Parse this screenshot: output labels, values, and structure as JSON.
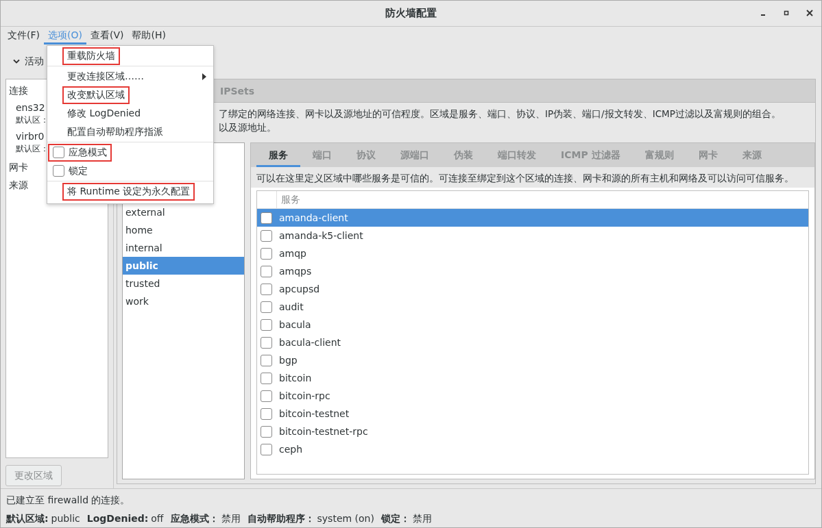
{
  "window": {
    "title": "防火墙配置"
  },
  "menu_bar": [
    {
      "label": "文件(F)",
      "selected": false
    },
    {
      "label": "选项(O)",
      "selected": true
    },
    {
      "label": "查看(V)",
      "selected": false
    },
    {
      "label": "帮助(H)",
      "selected": false
    }
  ],
  "open_menu": {
    "items": [
      {
        "kind": "action",
        "label": "重载防火墙",
        "highlighted": true
      },
      {
        "kind": "separator"
      },
      {
        "kind": "submenu",
        "label": "更改连接区域……",
        "highlighted": false
      },
      {
        "kind": "action",
        "label": "改变默认区域",
        "highlighted": true
      },
      {
        "kind": "action",
        "label": "修改  LogDenied",
        "highlighted": false
      },
      {
        "kind": "action",
        "label": "配置自动帮助程序指派",
        "highlighted": false
      },
      {
        "kind": "separator"
      },
      {
        "kind": "check",
        "label": "应急模式",
        "checked": false,
        "highlighted": true
      },
      {
        "kind": "check",
        "label": "锁定",
        "checked": false,
        "highlighted": false
      },
      {
        "kind": "separator"
      },
      {
        "kind": "action",
        "label": "将  Runtime 设定为永久配置",
        "highlighted": true
      }
    ]
  },
  "bindings_panel": {
    "header": "活动",
    "items": [
      {
        "kind": "group",
        "label": "连接"
      },
      {
        "kind": "entry",
        "label": "ens32",
        "zone": "默认区："
      },
      {
        "kind": "entry",
        "label": "virbr0",
        "zone": "默认区："
      },
      {
        "kind": "group",
        "label": "网卡"
      },
      {
        "kind": "group",
        "label": "来源"
      }
    ],
    "button": {
      "label": "更改区域",
      "disabled": true
    }
  },
  "top_tabs": [
    {
      "label": "IPSets",
      "selected": false
    }
  ],
  "zone_description": [
    "了绑定的网络连接、网卡以及源地址的可信程度。区域是服务、端口、协议、IP伪装、端口/报文转发、ICMP过滤以及富规则的组合。",
    "以及源地址。"
  ],
  "zones": [
    {
      "name": "external",
      "selected": false
    },
    {
      "name": "home",
      "selected": false
    },
    {
      "name": "internal",
      "selected": false
    },
    {
      "name": "public",
      "selected": true
    },
    {
      "name": "trusted",
      "selected": false
    },
    {
      "name": "work",
      "selected": false
    }
  ],
  "zone_tabs": [
    {
      "label": "服务",
      "selected": true
    },
    {
      "label": "端口",
      "selected": false
    },
    {
      "label": "协议",
      "selected": false
    },
    {
      "label": "源端口",
      "selected": false
    },
    {
      "label": "伪装",
      "selected": false
    },
    {
      "label": "端口转发",
      "selected": false
    },
    {
      "label": "ICMP 过滤器",
      "selected": false
    },
    {
      "label": "富规则",
      "selected": false
    },
    {
      "label": "网卡",
      "selected": false
    },
    {
      "label": "来源",
      "selected": false
    }
  ],
  "services_description": "可以在这里定义区域中哪些服务是可信的。可连接至绑定到这个区域的连接、网卡和源的所有主机和网络及可以访问可信服务。",
  "services_table": {
    "columns": [
      "服务"
    ],
    "rows": [
      {
        "name": "amanda-client",
        "checked": false,
        "selected": true
      },
      {
        "name": "amanda-k5-client",
        "checked": false,
        "selected": false
      },
      {
        "name": "amqp",
        "checked": false,
        "selected": false
      },
      {
        "name": "amqps",
        "checked": false,
        "selected": false
      },
      {
        "name": "apcupsd",
        "checked": false,
        "selected": false
      },
      {
        "name": "audit",
        "checked": false,
        "selected": false
      },
      {
        "name": "bacula",
        "checked": false,
        "selected": false
      },
      {
        "name": "bacula-client",
        "checked": false,
        "selected": false
      },
      {
        "name": "bgp",
        "checked": false,
        "selected": false
      },
      {
        "name": "bitcoin",
        "checked": false,
        "selected": false
      },
      {
        "name": "bitcoin-rpc",
        "checked": false,
        "selected": false
      },
      {
        "name": "bitcoin-testnet",
        "checked": false,
        "selected": false
      },
      {
        "name": "bitcoin-testnet-rpc",
        "checked": false,
        "selected": false
      },
      {
        "name": "ceph",
        "checked": false,
        "selected": false
      }
    ]
  },
  "status_bar": {
    "message": "已建立至  firewalld 的连接。",
    "fields": [
      {
        "label": "默认区域:",
        "value": "public"
      },
      {
        "label": "LogDenied:",
        "value": "off"
      },
      {
        "label": "应急模式：",
        "value": "禁用"
      },
      {
        "label": "自动帮助程序：",
        "value": "system (on)"
      },
      {
        "label": "锁定：",
        "value": "禁用"
      }
    ]
  }
}
